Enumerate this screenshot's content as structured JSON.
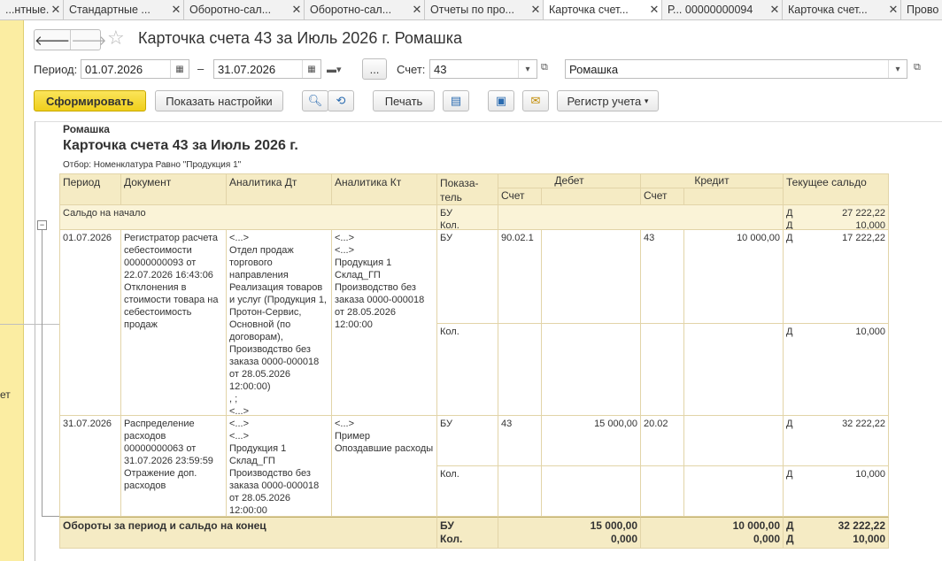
{
  "tabs": [
    {
      "label": "...нтные..."
    },
    {
      "label": "Стандартные ..."
    },
    {
      "label": "Оборотно-сал..."
    },
    {
      "label": "Оборотно-сал..."
    },
    {
      "label": "Отчеты по про..."
    },
    {
      "label": "Карточка счет..."
    },
    {
      "label": "Р... 00000000094"
    },
    {
      "label": "Карточка счет..."
    },
    {
      "label": "Прово"
    }
  ],
  "leftbar_text": "ет",
  "window": {
    "title": "Карточка счета 43 за Июль 2026 г. Ромашка"
  },
  "filters": {
    "period_label": "Период:",
    "date_from": "01.07.2026",
    "dash": "–",
    "date_to": "31.07.2026",
    "ellipsis": "...",
    "account_label": "Счет:",
    "account": "43",
    "organization": "Ромашка"
  },
  "toolbar": {
    "generate": "Сформировать",
    "show_settings": "Показать настройки",
    "print": "Печать",
    "register": "Регистр учета"
  },
  "report": {
    "org": "Ромашка",
    "title": "Карточка счета 43 за Июль 2026 г.",
    "filter": "Отбор: Номенклатура Равно \"Продукция 1\"",
    "headers": {
      "period": "Период",
      "document": "Документ",
      "an_dt": "Аналитика Дт",
      "an_kt": "Аналитика Кт",
      "indicator": "Показа-\nтель",
      "debit": "Дебет",
      "credit": "Кредит",
      "balance": "Текущее сальдо",
      "account": "Счет"
    },
    "opening": {
      "label": "Сальдо на начало",
      "ind1": "БУ",
      "ind2": "Кол.",
      "dk1": "Д",
      "bal1": "27 222,22",
      "dk2": "Д",
      "bal2": "10,000"
    },
    "rows": [
      {
        "period": "01.07.2026",
        "document": "Регистратор расчета себестоимости 00000000093 от 22.07.2026 16:43:06 Отклонения в стоимости товара на себестоимость продаж",
        "an_dt": "<...>\nОтдел продаж торгового направления\nРеализация товаров и услуг (Продукция 1, Протон-Сервис, Основной (по договорам), Производство без заказа 0000-000018 от 28.05.2026 12:00:00)\n, ;\n<...>",
        "an_kt": "<...>\n<...>\nПродукция 1\nСклад_ГП\nПроизводство без заказа 0000-000018 от 28.05.2026 12:00:00",
        "ind1": "БУ",
        "ind2": "Кол.",
        "dt_acc": "90.02.1",
        "dt_sum": "",
        "kt_acc": "43",
        "kt_sum": "10 000,00",
        "dk1": "Д",
        "bal1": "17 222,22",
        "dk2": "Д",
        "bal2": "10,000"
      },
      {
        "period": "31.07.2026",
        "document": "Распределение расходов 00000000063 от 31.07.2026 23:59:59 Отражение доп. расходов",
        "an_dt": "<...>\n<...>\nПродукция 1\nСклад_ГП\nПроизводство без заказа 0000-000018 от 28.05.2026 12:00:00",
        "an_kt": "<...>\nПример\nОпоздавшие расходы",
        "ind1": "БУ",
        "ind2": "Кол.",
        "dt_acc": "43",
        "dt_sum": "15 000,00",
        "kt_acc": "20.02",
        "kt_sum": "",
        "dk1": "Д",
        "bal1": "32 222,22",
        "dk2": "Д",
        "bal2": "10,000"
      }
    ],
    "totals": {
      "label": "Обороты за период и сальдо на конец",
      "ind1": "БУ",
      "ind2": "Кол.",
      "dt1": "15 000,00",
      "dt2": "0,000",
      "kt1": "10 000,00",
      "kt2": "0,000",
      "dk1": "Д",
      "bal1": "32 222,22",
      "dk2": "Д",
      "bal2": "10,000"
    }
  },
  "colors": {
    "accent": "#f0d020",
    "header_bg": "#f5ebc4",
    "grid": "#e2d4a8",
    "leftbar": "#fbeda2"
  }
}
